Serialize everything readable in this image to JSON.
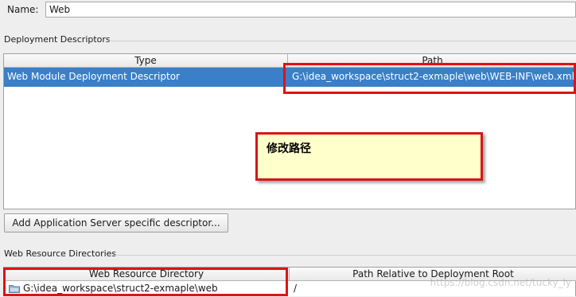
{
  "name": {
    "label": "Name:",
    "value": "Web"
  },
  "deployment_descriptors": {
    "title": "Deployment Descriptors",
    "columns": [
      "Type",
      "Path"
    ],
    "rows": [
      {
        "type": "Web Module Deployment Descriptor",
        "path": "G:\\idea_workspace\\struct2-exmaple\\web\\WEB-INF\\web.xml"
      }
    ]
  },
  "annotation": {
    "text": "修改路径"
  },
  "add_descriptor_button": {
    "label": "Add Application Server specific descriptor..."
  },
  "web_resource_directories": {
    "title": "Web Resource Directories",
    "columns": [
      "Web Resource Directory",
      "Path Relative to Deployment Root"
    ],
    "rows": [
      {
        "directory": "G:\\idea_workspace\\struct2-exmaple\\web",
        "relative_path": "/"
      }
    ]
  },
  "watermark": {
    "text": "https://blog.csdn.net/tucky_ly"
  },
  "icons": {
    "directory_row": "folder-icon"
  },
  "colors": {
    "selection": "#3a7fc8",
    "highlight_box": "#e01212",
    "note_background": "#ffffcc"
  }
}
